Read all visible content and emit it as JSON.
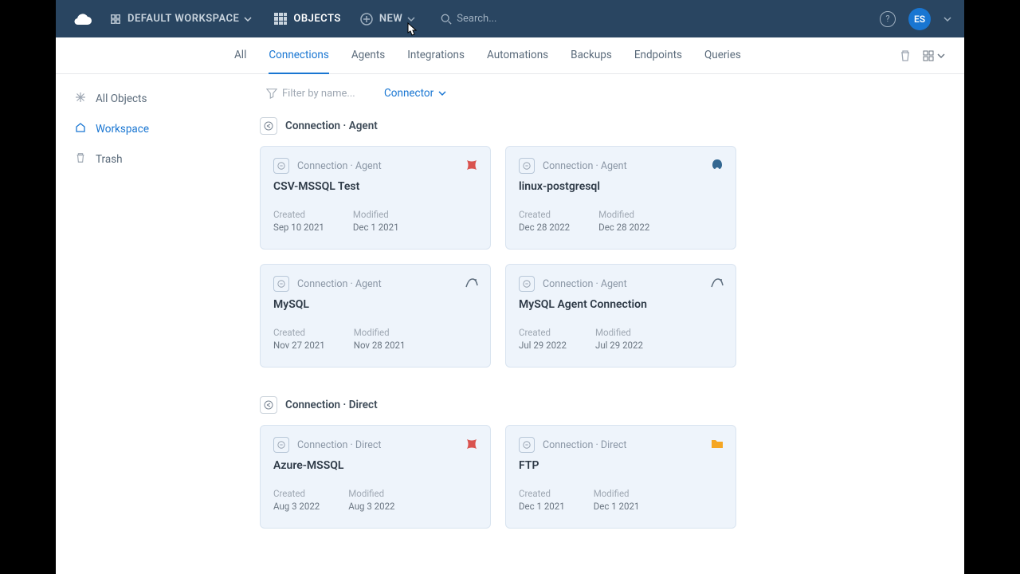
{
  "topbar": {
    "workspace_label": "DEFAULT WORKSPACE",
    "objects_label": "OBJECTS",
    "new_label": "NEW",
    "search_placeholder": "Search...",
    "avatar_initials": "ES"
  },
  "tabs": [
    {
      "label": "All",
      "active": false
    },
    {
      "label": "Connections",
      "active": true
    },
    {
      "label": "Agents",
      "active": false
    },
    {
      "label": "Integrations",
      "active": false
    },
    {
      "label": "Automations",
      "active": false
    },
    {
      "label": "Backups",
      "active": false
    },
    {
      "label": "Endpoints",
      "active": false
    },
    {
      "label": "Queries",
      "active": false
    }
  ],
  "sidebar": [
    {
      "label": "All Objects",
      "icon": "asterisk-icon",
      "active": false
    },
    {
      "label": "Workspace",
      "icon": "workspace-icon",
      "active": true
    },
    {
      "label": "Trash",
      "icon": "trash-icon",
      "active": false
    }
  ],
  "filters": {
    "name_placeholder": "Filter by name...",
    "connector_label": "Connector"
  },
  "groups": [
    {
      "title": "Connection · Agent",
      "cards": [
        {
          "type": "Connection · Agent",
          "title": "CSV-MSSQL Test",
          "tech": "mssql",
          "created_label": "Created",
          "created": "Sep 10 2021",
          "modified_label": "Modified",
          "modified": "Dec 1 2021"
        },
        {
          "type": "Connection · Agent",
          "title": "linux-postgresql",
          "tech": "postgres",
          "created_label": "Created",
          "created": "Dec 28 2022",
          "modified_label": "Modified",
          "modified": "Dec 28 2022"
        },
        {
          "type": "Connection · Agent",
          "title": "MySQL",
          "tech": "mysql",
          "created_label": "Created",
          "created": "Nov 27 2021",
          "modified_label": "Modified",
          "modified": "Nov 28 2021"
        },
        {
          "type": "Connection · Agent",
          "title": "MySQL Agent Connection",
          "tech": "mysql",
          "created_label": "Created",
          "created": "Jul 29 2022",
          "modified_label": "Modified",
          "modified": "Jul 29 2022"
        }
      ]
    },
    {
      "title": "Connection · Direct",
      "cards": [
        {
          "type": "Connection · Direct",
          "title": "Azure-MSSQL",
          "tech": "mssql",
          "created_label": "Created",
          "created": "Aug 3 2022",
          "modified_label": "Modified",
          "modified": "Aug 3 2022"
        },
        {
          "type": "Connection · Direct",
          "title": "FTP",
          "tech": "folder",
          "created_label": "Created",
          "created": "Dec 1 2021",
          "modified_label": "Modified",
          "modified": "Dec 1 2021"
        }
      ]
    }
  ]
}
